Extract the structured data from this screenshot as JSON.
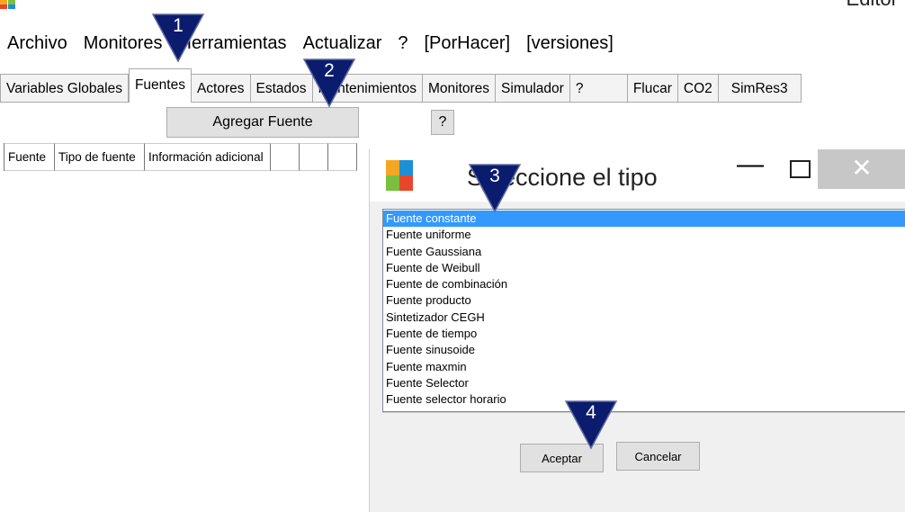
{
  "window": {
    "title": "Editor"
  },
  "menu": [
    "Archivo",
    "Monitores",
    "Herramientas",
    "Actualizar",
    "?",
    "[PorHacer]",
    "[versiones]"
  ],
  "tabs": [
    "Variables Globales",
    "Fuentes",
    "Actores",
    "Estados",
    "Mantenimientos",
    "Monitores",
    "Simulador",
    "?",
    "",
    "Flucar",
    "CO2",
    "SimRes3"
  ],
  "active_tab": "Fuentes",
  "toolbar": {
    "add_source_label": "Agregar Fuente",
    "help_label": "?"
  },
  "table": {
    "columns": [
      "Fuente",
      "Tipo de fuente",
      "Información adicional",
      "",
      "",
      ""
    ]
  },
  "dialog": {
    "title": "Seleccione el tipo",
    "close_glyph": "✕",
    "minimize_glyph": "—",
    "list_items": [
      "Fuente constante",
      "Fuente uniforme",
      "Fuente Gaussiana",
      "Fuente de Weibull",
      "Fuente de combinación",
      "Fuente producto",
      "Sintetizador CEGH",
      "Fuente de tiempo",
      "Fuente sinusoide",
      "Fuente maxmin",
      "Fuente Selector",
      "Fuente selector horario"
    ],
    "selected_index": 0,
    "accept_label": "Aceptar",
    "cancel_label": "Cancelar"
  },
  "callouts": [
    "1",
    "2",
    "3",
    "4"
  ],
  "colors": {
    "callout_fill": "#0b1b6e",
    "selection": "#3399ff",
    "logo": [
      "#e8462b",
      "#7bbf3e",
      "#1e8fd6",
      "#f5a623"
    ]
  },
  "icons": {
    "app": "app-logo-icon",
    "minimize": "minimize-icon",
    "maximize": "maximize-icon",
    "close": "close-icon"
  }
}
